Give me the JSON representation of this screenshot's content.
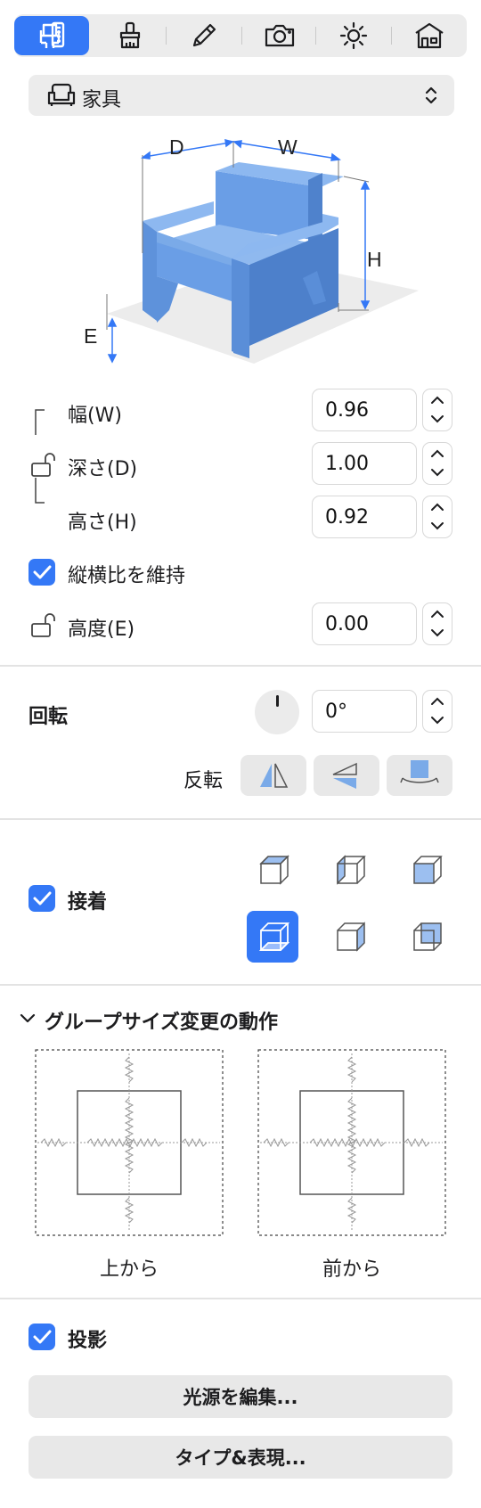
{
  "toolbar": {
    "tabs": [
      {
        "name": "dimensions",
        "icon": "ruler-chair-icon",
        "active": true
      },
      {
        "name": "style",
        "icon": "brush-icon"
      },
      {
        "name": "edit",
        "icon": "pencil-icon"
      },
      {
        "name": "camera",
        "icon": "camera-icon"
      },
      {
        "name": "light",
        "icon": "sun-icon"
      },
      {
        "name": "building",
        "icon": "house-icon"
      }
    ]
  },
  "category": {
    "label": "家具",
    "icon": "armchair-icon"
  },
  "diagram": {
    "d": "D",
    "w": "W",
    "h": "H",
    "e": "E"
  },
  "dimensions": {
    "width": {
      "label": "幅(W)",
      "value": "0.96"
    },
    "depth": {
      "label": "深さ(D)",
      "value": "1.00"
    },
    "height": {
      "label": "高さ(H)",
      "value": "0.92"
    },
    "keep_ratio": {
      "label": "縦横比を維持",
      "checked": true
    },
    "elevation": {
      "label": "高度(E)",
      "value": "0.00"
    }
  },
  "rotation": {
    "title": "回転",
    "value": "0°",
    "flip_label": "反転"
  },
  "snap": {
    "label": "接着",
    "checked": true,
    "active_index": 3
  },
  "group_resize": {
    "title": "グループサイズ変更の動作",
    "top_caption": "上から",
    "front_caption": "前から"
  },
  "shadow": {
    "label": "投影",
    "checked": true
  },
  "buttons": {
    "edit_light": "光源を編集...",
    "type_display": "タイプ&表現..."
  },
  "colors": {
    "accent": "#3478f6",
    "chair": "#5b8fd9"
  }
}
